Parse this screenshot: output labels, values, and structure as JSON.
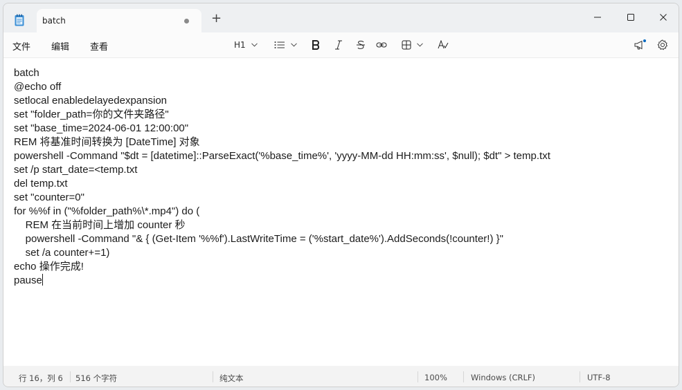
{
  "tab": {
    "title": "batch"
  },
  "menu": {
    "file": "文件",
    "edit": "编辑",
    "view": "查看"
  },
  "toolbar": {
    "heading": "H1"
  },
  "editor": {
    "lines": [
      "batch",
      "@echo off",
      "setlocal enabledelayedexpansion",
      "set \"folder_path=你的文件夹路径\"",
      "set \"base_time=2024-06-01 12:00:00\"",
      "REM 将基准时间转换为 [DateTime] 对象",
      "powershell -Command \"$dt = [datetime]::ParseExact('%base_time%', 'yyyy-MM-dd HH:mm:ss', $null); $dt\" > temp.txt",
      "set /p start_date=<temp.txt",
      "del temp.txt",
      "set \"counter=0\"",
      "for %%f in (\"%folder_path%\\*.mp4\") do (",
      "    REM 在当前时间上增加 counter 秒",
      "    powershell -Command \"& { (Get-Item '%%f').LastWriteTime = ('%start_date%').AddSeconds(!counter!) }\"",
      "    set /a counter+=1)",
      "echo 操作完成!",
      "pause"
    ]
  },
  "status": {
    "position": "行 16，列 6",
    "char_count": "516 个字符",
    "format": "纯文本",
    "zoom": "100%",
    "line_ending": "Windows (CRLF)",
    "encoding": "UTF-8"
  },
  "colors": {
    "accent": "#0067c0",
    "editor_bg": "#ffffff",
    "chrome_bg": "#f3f3f3"
  }
}
